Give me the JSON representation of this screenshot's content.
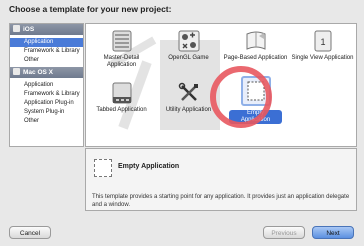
{
  "dialog": {
    "title": "Choose a template for your new project:"
  },
  "sidebar": {
    "sections": [
      {
        "label": "iOS",
        "items": [
          "Application",
          "Framework & Library",
          "Other"
        ],
        "selected": 0
      },
      {
        "label": "Mac OS X",
        "items": [
          "Application",
          "Framework & Library",
          "Application Plug-in",
          "System Plug-in",
          "Other"
        ]
      }
    ]
  },
  "templates": [
    {
      "label": "Master-Detail Application",
      "icon": "master-detail-icon"
    },
    {
      "label": "OpenGL Game",
      "icon": "opengl-icon"
    },
    {
      "label": "Page-Based Application",
      "icon": "page-based-icon"
    },
    {
      "label": "Single View Application",
      "icon": "single-view-icon"
    },
    {
      "label": "Tabbed Application",
      "icon": "tabbed-icon"
    },
    {
      "label": "Utility Application",
      "icon": "utility-icon"
    },
    {
      "label": "Empty Application",
      "icon": "empty-app-icon",
      "selected": true
    }
  ],
  "description": {
    "title": "Empty Application",
    "text": "This template provides a starting point for any application. It provides just an application delegate and a window."
  },
  "buttons": {
    "cancel": "Cancel",
    "previous": "Previous",
    "next": "Next"
  },
  "colors": {
    "selection": "#3b6fd4",
    "highlight_ring": "#e8585f"
  }
}
